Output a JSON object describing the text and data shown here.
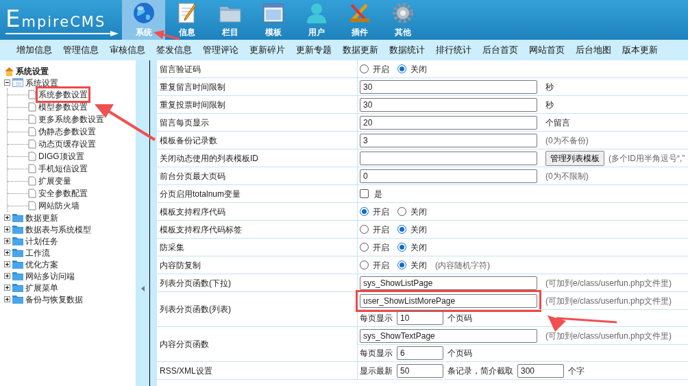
{
  "logo": "EmpireCMS",
  "nav": [
    {
      "label": "系统",
      "selected": true
    },
    {
      "label": "信息",
      "selected": false
    },
    {
      "label": "栏目",
      "selected": false
    },
    {
      "label": "模板",
      "selected": false
    },
    {
      "label": "用户",
      "selected": false
    },
    {
      "label": "插件",
      "selected": false
    },
    {
      "label": "其他",
      "selected": false
    }
  ],
  "menu": [
    "增加信息",
    "管理信息",
    "审核信息",
    "签发信息",
    "管理评论",
    "更新碎片",
    "更新专题",
    "数据更新",
    "数据统计",
    "排行统计",
    "后台首页",
    "网站首页",
    "后台地图",
    "版本更新"
  ],
  "sidebar": {
    "title": "系统设置",
    "items": [
      {
        "label": "系统设置",
        "expanded": true,
        "children": [
          {
            "label": "系统参数设置",
            "highlighted": true
          },
          {
            "label": "模型参数设置",
            "highlighted": false
          },
          {
            "label": "更多系统参数设置",
            "highlighted": false
          },
          {
            "label": "伪静态参数设置",
            "highlighted": false
          },
          {
            "label": "动态页缓存设置",
            "highlighted": false
          },
          {
            "label": "DIGG顶设置",
            "highlighted": false
          },
          {
            "label": "手机短信设置",
            "highlighted": false
          },
          {
            "label": "扩展变量",
            "highlighted": false
          },
          {
            "label": "安全参数配置",
            "highlighted": false
          },
          {
            "label": "网站防火墙",
            "highlighted": false
          }
        ]
      },
      {
        "label": "数据更新",
        "expanded": false
      },
      {
        "label": "数据表与系统模型",
        "expanded": false
      },
      {
        "label": "计划任务",
        "expanded": false
      },
      {
        "label": "工作流",
        "expanded": false
      },
      {
        "label": "优化方案",
        "expanded": false
      },
      {
        "label": "网站多访问端",
        "expanded": false
      },
      {
        "label": "扩展菜单",
        "expanded": false
      },
      {
        "label": "备份与恢复数据",
        "expanded": false
      }
    ]
  },
  "rows": [
    {
      "label": "留言验证码",
      "lines": [
        [
          {
            "kind": "radio",
            "label": "开启",
            "selected": false
          },
          {
            "kind": "radio",
            "label": "关闭",
            "selected": true
          }
        ]
      ]
    },
    {
      "label": "重复留言时间限制",
      "lines": [
        [
          {
            "kind": "input",
            "value": "30",
            "highlighted": false
          },
          {
            "kind": "text",
            "text": "秒"
          }
        ]
      ]
    },
    {
      "label": "重复投票时间限制",
      "lines": [
        [
          {
            "kind": "input",
            "value": "30",
            "highlighted": false
          },
          {
            "kind": "text",
            "text": "秒"
          }
        ]
      ]
    },
    {
      "label": "留言每页显示",
      "lines": [
        [
          {
            "kind": "input",
            "value": "20",
            "highlighted": false
          },
          {
            "kind": "text",
            "text": "个留言"
          }
        ]
      ]
    },
    {
      "label": "模板备份记录数",
      "lines": [
        [
          {
            "kind": "input",
            "value": "3",
            "highlighted": false
          },
          {
            "kind": "note",
            "text": "(0为不备份)"
          }
        ]
      ]
    },
    {
      "label": "关闭动态使用的列表模板ID",
      "lines": [
        [
          {
            "kind": "input",
            "highlighted": false
          },
          {
            "kind": "button",
            "text": "管理列表模板"
          },
          {
            "kind": "note",
            "text": "(多个ID用半角逗号“,”"
          }
        ]
      ]
    },
    {
      "label": "前台分页最大页码",
      "lines": [
        [
          {
            "kind": "input",
            "value": "0",
            "highlighted": false
          },
          {
            "kind": "note",
            "text": "(0为不限制)"
          }
        ]
      ]
    },
    {
      "label": "分页启用totalnum变量",
      "lines": [
        [
          {
            "kind": "checkbox",
            "label": "是",
            "checked": false
          }
        ]
      ]
    },
    {
      "label": "模板支持程序代码",
      "lines": [
        [
          {
            "kind": "radio",
            "label": "开启",
            "selected": true
          },
          {
            "kind": "radio",
            "label": "关闭",
            "selected": false
          }
        ]
      ]
    },
    {
      "label": "模板支持程序代码标签",
      "lines": [
        [
          {
            "kind": "radio",
            "label": "开启",
            "selected": false
          },
          {
            "kind": "radio",
            "label": "关闭",
            "selected": true
          }
        ]
      ]
    },
    {
      "label": "防采集",
      "lines": [
        [
          {
            "kind": "radio",
            "label": "开启",
            "selected": false
          },
          {
            "kind": "radio",
            "label": "关闭",
            "selected": true
          }
        ]
      ]
    },
    {
      "label": "内容防复制",
      "lines": [
        [
          {
            "kind": "radio",
            "label": "开启",
            "selected": false
          },
          {
            "kind": "radio",
            "label": "关闭",
            "selected": true
          },
          {
            "kind": "note",
            "text": "(内容随机字符)"
          }
        ]
      ]
    },
    {
      "label": "列表分页函数(下拉)",
      "lines": [
        [
          {
            "kind": "input",
            "value": "sys_ShowListPage",
            "highlighted": false
          },
          {
            "kind": "note",
            "text": "(可加到e/class/userfun.php文件里)"
          }
        ]
      ]
    },
    {
      "label": "列表分页函数(列表)",
      "lines": [
        [
          {
            "kind": "input",
            "value": "user_ShowListMorePage",
            "highlighted": true
          },
          {
            "kind": "note",
            "text": "(可加到e/class/userfun.php文件里)"
          }
        ],
        [
          {
            "kind": "text",
            "text": "每页显示"
          },
          {
            "kind": "small-input",
            "value": "10"
          },
          {
            "kind": "text",
            "text": "个页码"
          }
        ]
      ]
    },
    {
      "label": "内容分页函数",
      "lines": [
        [
          {
            "kind": "input",
            "value": "sys_ShowTextPage",
            "highlighted": false
          },
          {
            "kind": "note",
            "text": "(可加到e/class/userfun.php文件里)"
          }
        ],
        [
          {
            "kind": "text",
            "text": "每页显示"
          },
          {
            "kind": "small-input",
            "value": "6"
          },
          {
            "kind": "text",
            "text": "个页码"
          }
        ]
      ]
    },
    {
      "label": "RSS/XML设置",
      "lines": [
        [
          {
            "kind": "text",
            "text": "显示最新"
          },
          {
            "kind": "small-input",
            "value": "50"
          },
          {
            "kind": "text",
            "text": "条记录，简介截取"
          },
          {
            "kind": "small-input",
            "value": "300"
          },
          {
            "kind": "text",
            "text": "个字"
          }
        ]
      ]
    }
  ]
}
